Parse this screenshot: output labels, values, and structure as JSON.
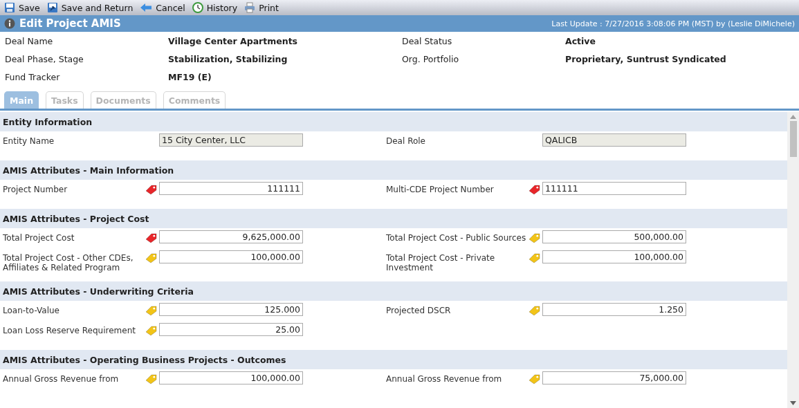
{
  "toolbar": [
    {
      "label": "Save",
      "kind": "save"
    },
    {
      "label": "Save and Return",
      "kind": "save-return"
    },
    {
      "label": "Cancel",
      "kind": "back"
    },
    {
      "label": "History",
      "kind": "history"
    },
    {
      "label": "Print",
      "kind": "print"
    }
  ],
  "title": "Edit Project AMIS",
  "last_update": "Last Update : 7/27/2016 3:08:06 PM (MST) by (Leslie DiMichele)",
  "summary": [
    {
      "label": "Deal Name",
      "value": "Village Center Apartments"
    },
    {
      "label": "Deal Status",
      "value": "Active"
    },
    {
      "label": "Deal Phase, Stage",
      "value": "Stabilization, Stabilizing"
    },
    {
      "label": "Org. Portfolio",
      "value": "Proprietary, Suntrust Syndicated"
    },
    {
      "label": "Fund Tracker",
      "value": "MF19 (E)"
    }
  ],
  "tabs": [
    {
      "label": "Main",
      "selected": true
    },
    {
      "label": "Tasks",
      "selected": false
    },
    {
      "label": "Documents",
      "selected": false
    },
    {
      "label": "Comments",
      "selected": false
    }
  ],
  "sections": [
    {
      "title": "Entity Information",
      "rows": [
        [
          {
            "label": "Entity Name",
            "value": "15 City Center, LLC",
            "kind": "text",
            "readonly": true
          },
          {
            "label": "Deal Role",
            "value": "QALICB",
            "kind": "text",
            "readonly": true
          }
        ]
      ]
    },
    {
      "title": "AMIS Attributes - Main Information",
      "rows": [
        [
          {
            "label": "Project Number",
            "value": "111111",
            "kind": "number",
            "readonly": false,
            "color": "#e8262a"
          },
          {
            "label": "Multi-CDE Project Number",
            "value": "111111",
            "kind": "text",
            "readonly": false,
            "color": "#e8262a"
          }
        ]
      ]
    },
    {
      "title": "AMIS Attributes - Project Cost",
      "rows": [
        [
          {
            "label": "Total Project Cost",
            "value": "9,625,000.00",
            "kind": "number",
            "readonly": false,
            "color": "#e8262a"
          },
          {
            "label": "Total Project Cost - Public Sources",
            "value": "500,000.00",
            "kind": "number",
            "readonly": false,
            "color": "#f2c418"
          }
        ],
        [
          {
            "label": "Total Project Cost - Other CDEs, Affiliates & Related Program",
            "value": "100,000.00",
            "kind": "number",
            "readonly": false,
            "color": "#f2c418"
          },
          {
            "label": "Total Project Cost - Private Investment",
            "value": "100,000.00",
            "kind": "number",
            "readonly": false,
            "color": "#f2c418"
          }
        ]
      ]
    },
    {
      "title": "AMIS Attributes - Underwriting Criteria",
      "rows": [
        [
          {
            "label": "Loan-to-Value",
            "value": "125.000",
            "kind": "number",
            "readonly": false,
            "color": "#f2c418"
          },
          {
            "label": "Projected DSCR",
            "value": "1.250",
            "kind": "number",
            "readonly": false,
            "color": "#f2c418"
          }
        ],
        [
          {
            "label": "Loan Loss Reserve Requirement",
            "value": "25.00",
            "kind": "number",
            "readonly": false,
            "color": "#f2c418"
          }
        ]
      ]
    },
    {
      "title": "AMIS Attributes - Operating Business Projects - Outcomes",
      "rows": [
        [
          {
            "label": "Annual Gross Revenue from",
            "value": "100,000.00",
            "kind": "number",
            "readonly": false,
            "color": "#f2c418"
          },
          {
            "label": "Annual Gross Revenue from",
            "value": "75,000.00",
            "kind": "number",
            "readonly": false,
            "color": "#f2c418"
          }
        ]
      ]
    }
  ]
}
